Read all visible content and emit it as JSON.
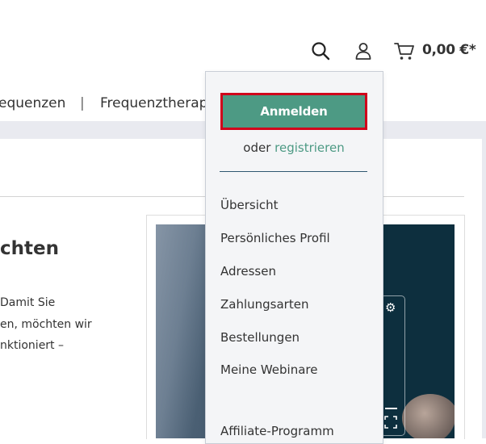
{
  "header": {
    "cart_total": "0,00 €*"
  },
  "nav": {
    "items": [
      "equenzen",
      "|",
      "Frequenztherap"
    ]
  },
  "content": {
    "title": "chten",
    "lines": [
      "Damit Sie",
      "en, möchten wir",
      "nktioniert –"
    ]
  },
  "account_dropdown": {
    "login_label": "Anmelden",
    "register_prefix": "oder ",
    "register_link": "registrieren",
    "menu_items": [
      "Übersicht",
      "Persönliches Profil",
      "Adressen",
      "Zahlungsarten",
      "Bestellungen",
      "Meine Webinare",
      "Affiliate-Programm"
    ]
  },
  "colors": {
    "brand_green": "#4d9a84",
    "highlight_red": "#d0021b",
    "background_gray": "#e9eaf0",
    "dropdown_bg": "#f4f5f7"
  },
  "icons": {
    "search": "search-icon",
    "account": "user-icon",
    "cart": "cart-icon",
    "video_settings": "gear-icon",
    "video_fullscreen": "fullscreen-icon"
  }
}
